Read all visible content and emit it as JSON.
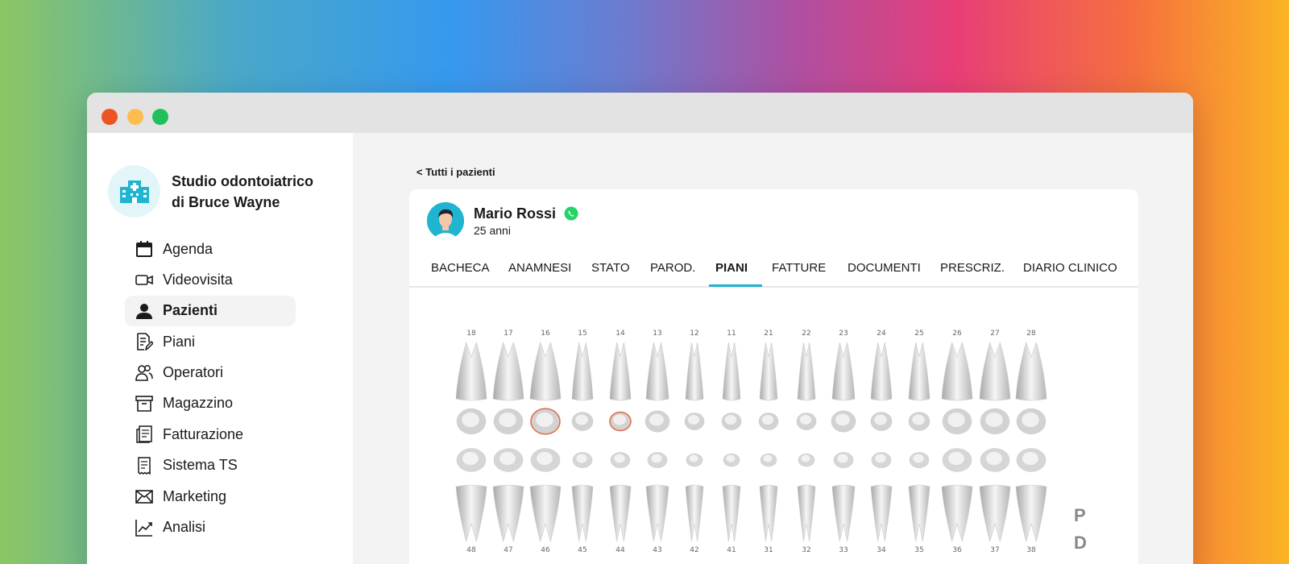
{
  "studio": {
    "name_line1": "Studio odontoiatrico",
    "name_line2": "di Bruce Wayne",
    "logo_icon": "hospital-icon"
  },
  "nav": {
    "items": [
      {
        "label": "Agenda",
        "icon": "calendar-icon"
      },
      {
        "label": "Videovisita",
        "icon": "video-icon"
      },
      {
        "label": "Pazienti",
        "icon": "user-icon",
        "active": true
      },
      {
        "label": "Piani",
        "icon": "document-edit-icon"
      },
      {
        "label": "Operatori",
        "icon": "users-icon"
      },
      {
        "label": "Magazzino",
        "icon": "archive-icon"
      },
      {
        "label": "Fatturazione",
        "icon": "invoice-icon"
      },
      {
        "label": "Sistema TS",
        "icon": "receipt-icon"
      },
      {
        "label": "Marketing",
        "icon": "mail-icon"
      },
      {
        "label": "Analisi",
        "icon": "chart-line-icon"
      }
    ]
  },
  "main": {
    "back_link": "< Tutti i pazienti"
  },
  "patient": {
    "name": "Mario Rossi",
    "age": "25 anni"
  },
  "tabs": [
    {
      "label": "BACHECA"
    },
    {
      "label": "ANAMNESI"
    },
    {
      "label": "STATO"
    },
    {
      "label": "PAROD."
    },
    {
      "label": "PIANI",
      "active": true
    },
    {
      "label": "FATTURE"
    },
    {
      "label": "DOCUMENTI"
    },
    {
      "label": "PRESCRIZ."
    },
    {
      "label": "DIARIO CLINICO"
    }
  ],
  "dental_chart": {
    "upper_numbers": [
      "18",
      "17",
      "16",
      "15",
      "14",
      "13",
      "12",
      "11",
      "21",
      "22",
      "23",
      "24",
      "25",
      "26",
      "27",
      "28"
    ],
    "lower_numbers": [
      "48",
      "47",
      "46",
      "45",
      "44",
      "43",
      "42",
      "41",
      "31",
      "32",
      "33",
      "34",
      "35",
      "36",
      "37",
      "38"
    ],
    "side_labels": [
      "P",
      "D"
    ],
    "highlighted_teeth": [
      "16",
      "14"
    ]
  },
  "colors": {
    "accent": "#1fb5d1",
    "whatsapp": "#25d366",
    "highlight": "#e07050"
  }
}
